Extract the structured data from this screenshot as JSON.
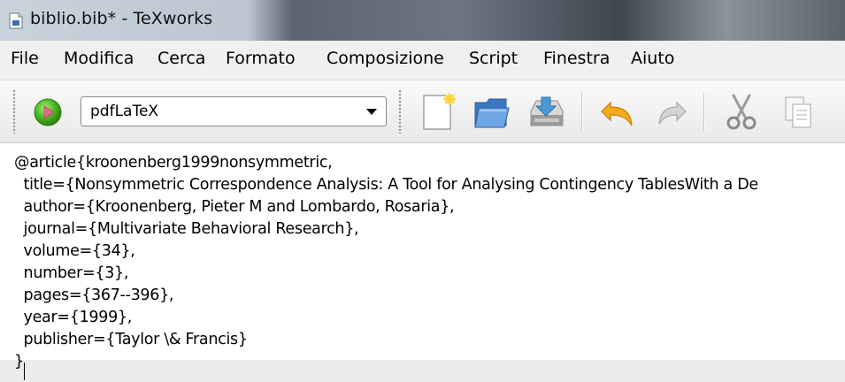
{
  "window": {
    "title": "biblio.bib* - TeXworks"
  },
  "menu": {
    "items": [
      "File",
      "Modifica",
      "Cerca",
      "Formato",
      "Composizione",
      "Script",
      "Finestra",
      "Aiuto"
    ]
  },
  "toolbar": {
    "engine": "pdfLaTeX",
    "icons": [
      "typeset-icon",
      "new-document-icon",
      "open-folder-icon",
      "save-icon",
      "undo-icon",
      "redo-icon",
      "cut-icon",
      "copy-icon"
    ]
  },
  "editor": {
    "lines": [
      "@article{kroonenberg1999nonsymmetric,",
      "  title={Nonsymmetric Correspondence Analysis: A Tool for Analysing Contingency TablesWith a De",
      "  author={Kroonenberg, Pieter M and Lombardo, Rosaria},",
      "  journal={Multivariate Behavioral Research},",
      "  volume={34},",
      "  number={3},",
      "  pages={367--396},",
      "  year={1999},",
      "  publisher={Taylor \\& Francis}",
      "}"
    ]
  }
}
